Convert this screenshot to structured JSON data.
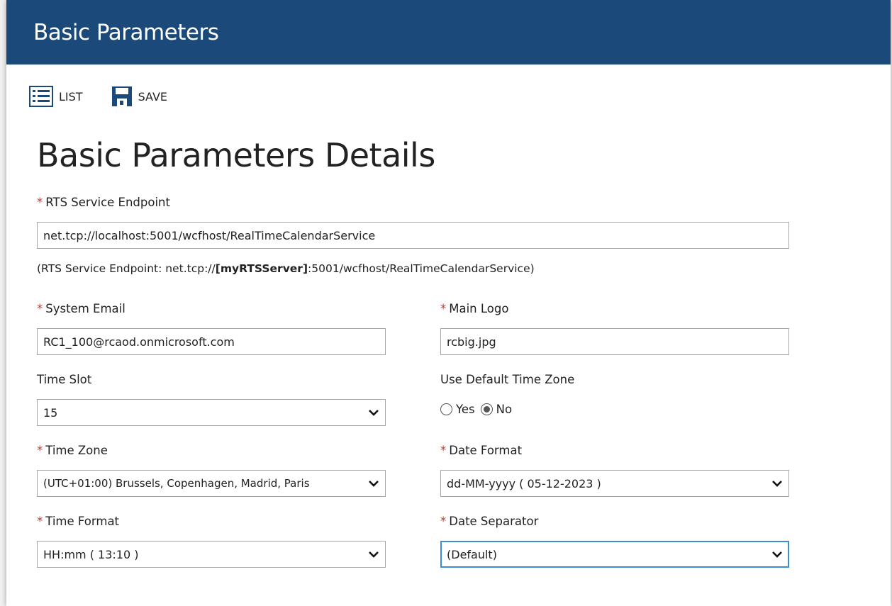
{
  "window": {
    "title": "Basic Parameters"
  },
  "toolbar": {
    "list_label": "LIST",
    "save_label": "SAVE"
  },
  "page": {
    "heading": "Basic Parameters Details"
  },
  "form": {
    "rts_endpoint": {
      "required_mark": "*",
      "label": "RTS Service Endpoint",
      "value": "net.tcp://localhost:5001/wcfhost/RealTimeCalendarService"
    },
    "endpoint_note": {
      "prefix": "(RTS Service Endpoint: net.tcp://",
      "bold": "[myRTSServer]",
      "suffix": ":5001/wcfhost/RealTimeCalendarService)"
    },
    "system_email": {
      "required_mark": "*",
      "label": "System Email",
      "value": "RC1_100@rcaod.onmicrosoft.com"
    },
    "main_logo": {
      "required_mark": "*",
      "label": "Main Logo",
      "value": "rcbig.jpg"
    },
    "time_slot": {
      "label": "Time Slot",
      "value": "15"
    },
    "use_default_tz": {
      "label": "Use Default Time Zone",
      "options": [
        {
          "label": "Yes",
          "checked": false
        },
        {
          "label": "No",
          "checked": true
        }
      ]
    },
    "time_zone": {
      "required_mark": "*",
      "label": "Time Zone",
      "value": "(UTC+01:00) Brussels, Copenhagen, Madrid, Paris"
    },
    "date_format": {
      "required_mark": "*",
      "label": "Date Format",
      "value": "dd-MM-yyyy ( 05-12-2023 )"
    },
    "time_format": {
      "required_mark": "*",
      "label": "Time Format",
      "value": "HH:mm ( 13:10 )"
    },
    "date_separator": {
      "required_mark": "*",
      "label": "Date Separator",
      "value": "(Default)"
    }
  },
  "colors": {
    "header_bg": "#1b4a7a",
    "required": "#c0392b",
    "focus": "#3b8ed4"
  },
  "icons": {
    "list": "list-icon",
    "save": "floppy-disk-icon",
    "select": "chevron-down-icon"
  }
}
